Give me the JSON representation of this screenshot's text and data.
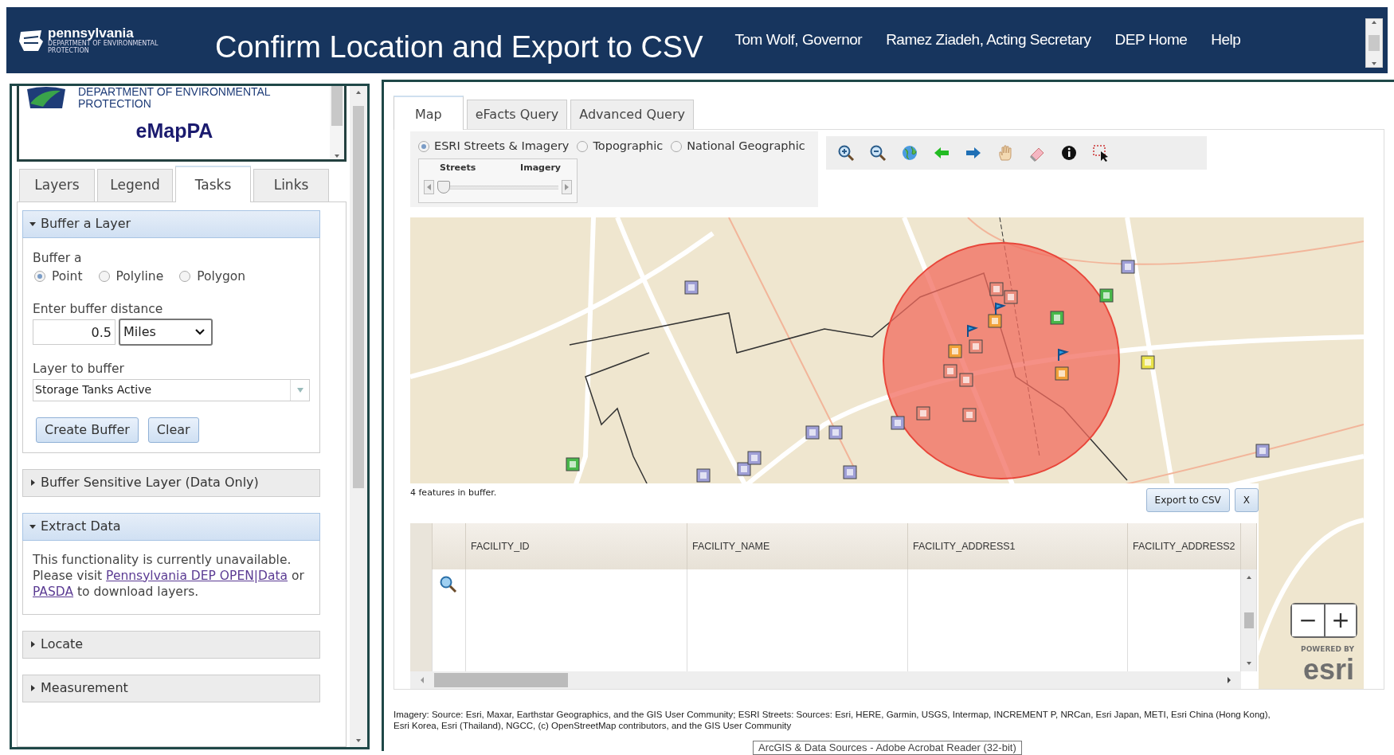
{
  "header": {
    "logo_name": "pennsylvania",
    "logo_sub": "DEPARTMENT OF ENVIRONMENTAL PROTECTION",
    "title": "Confirm Location and Export to CSV",
    "links": [
      "Tom Wolf, Governor",
      "Ramez Ziadeh, Acting Secretary",
      "DEP Home",
      "Help"
    ]
  },
  "sidebar": {
    "logo_lines": [
      "DEPARTMENT OF ENVIRONMENTAL",
      "PROTECTION"
    ],
    "app_name": "eMapPA",
    "tabs": [
      {
        "label": "Layers",
        "selected": false
      },
      {
        "label": "Legend",
        "selected": false
      },
      {
        "label": "Tasks",
        "selected": true
      },
      {
        "label": "Links",
        "selected": false
      }
    ],
    "sections": [
      {
        "title": "Buffer a Layer",
        "expanded": true,
        "kind": "buffer",
        "body": {
          "buffer_label": "Buffer a",
          "geometry_options": [
            {
              "label": "Point",
              "selected": true
            },
            {
              "label": "Polyline",
              "selected": false
            },
            {
              "label": "Polygon",
              "selected": false
            }
          ],
          "distance_label": "Enter buffer distance",
          "distance_value": "0.5",
          "unit": "Miles",
          "layer_label": "Layer to buffer",
          "layer_value": "Storage Tanks Active",
          "buttons": [
            "Create Buffer",
            "Clear"
          ]
        }
      },
      {
        "title": "Buffer Sensitive Layer (Data Only)",
        "expanded": false
      },
      {
        "title": "Extract Data",
        "expanded": true,
        "kind": "notice",
        "body": {
          "parts": [
            {
              "link": false,
              "text": "This functionality is currently unavailable. Please visit "
            },
            {
              "link": true,
              "text": "Pennsylvania DEP OPEN|Data"
            },
            {
              "link": false,
              "text": " or "
            },
            {
              "link": true,
              "text": "PASDA"
            },
            {
              "link": false,
              "text": " to download layers."
            }
          ]
        }
      },
      {
        "title": "Locate",
        "expanded": false
      },
      {
        "title": "Measurement",
        "expanded": false
      }
    ]
  },
  "map_panel": {
    "tabs": [
      {
        "label": "Map",
        "selected": true
      },
      {
        "label": "eFacts Query",
        "selected": false
      },
      {
        "label": "Advanced Query",
        "selected": false
      }
    ],
    "basemaps": [
      {
        "label": "ESRI Streets & Imagery",
        "selected": true
      },
      {
        "label": "Topographic",
        "selected": false
      },
      {
        "label": "National Geographic",
        "selected": false
      }
    ],
    "blend": {
      "left_label": "Streets",
      "right_label": "Imagery",
      "level": 0.05
    },
    "results": {
      "summary": "4 features in buffer.",
      "buttons": [
        "Export to CSV",
        "X"
      ],
      "columns": [
        "FACILITY_ID",
        "FACILITY_NAME",
        "FACILITY_ADDRESS1",
        "FACILITY_ADDRESS2"
      ]
    },
    "zoom_buttons": [
      "−",
      "+"
    ],
    "esri": {
      "tag": "POWERED BY",
      "name": "esri"
    },
    "attribution": [
      "Imagery: Source: Esri, Maxar, Earthstar Geographics, and the GIS User Community; ESRI Streets: Sources: Esri, HERE, Garmin, USGS, Intermap, INCREMENT P, NRCan, Esri Japan, METI, Esri China (Hong Kong),",
      "Esri Korea, Esri (Thailand), NGCC, (c) OpenStreetMap contributors, and the GIS User Community"
    ],
    "tooltip": "ArcGIS & Data Sources - Adobe Acrobat Reader (32-bit)"
  }
}
